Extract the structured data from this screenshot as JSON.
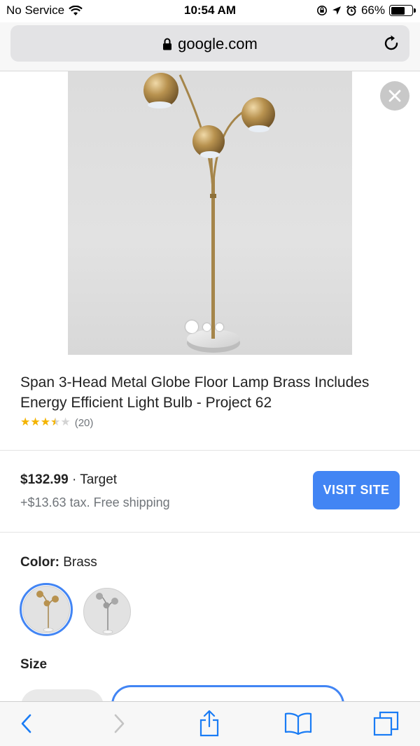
{
  "status": {
    "carrier": "No Service",
    "time": "10:54 AM",
    "battery_percent": "66%",
    "battery_level": 0.66
  },
  "browser": {
    "url": "google.com"
  },
  "product": {
    "title": "Span 3-Head Metal Globe Floor Lamp Brass Includes Energy Efficient Light Bulb - Project 62",
    "rating": 3.5,
    "rating_count": "(20)",
    "image_count": 3
  },
  "offer": {
    "price": "$132.99",
    "separator": " · ",
    "store": "Target",
    "tax_shipping": "+$13.63 tax. Free shipping",
    "visit_label": "VISIT SITE"
  },
  "options": {
    "color_label": "Color:",
    "color_value": "Brass",
    "size_label": "Size"
  },
  "colors": {
    "accent": "#4285f4",
    "star": "#f4b400",
    "brass": "#b8924f"
  }
}
